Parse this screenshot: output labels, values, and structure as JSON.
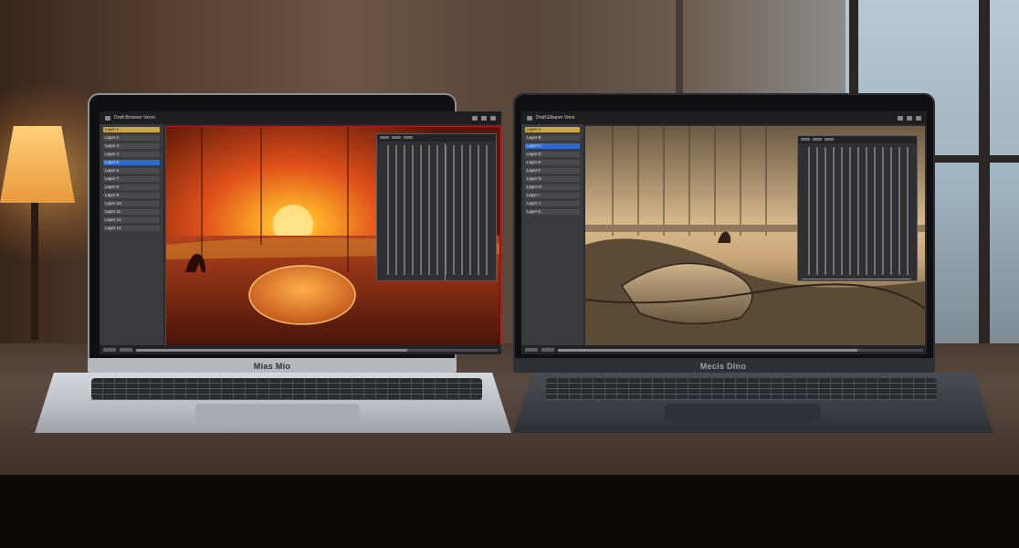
{
  "laptop_left": {
    "brand": "Mias Mio",
    "app_title": "Draft Browser Verso",
    "layers": [
      "Layer 1",
      "Layer 2",
      "Layer 3",
      "Layer 4",
      "Layer 5",
      "Layer 6",
      "Layer 7",
      "Layer 8",
      "Layer 9",
      "Layer 10",
      "Layer 11",
      "Layer 12",
      "Layer 13"
    ],
    "selected_layer_index": 4,
    "scroll_progress": 0.75
  },
  "laptop_right": {
    "brand": "Mecis Dlno",
    "app_title": "Draft Elbaren Vresi",
    "layers": [
      "Layer A",
      "Layer B",
      "Layer C",
      "Layer D",
      "Layer E",
      "Layer F",
      "Layer G",
      "Layer H",
      "Layer I",
      "Layer J",
      "Layer K"
    ],
    "selected_layer_index": 2,
    "scroll_progress": 0.82
  },
  "colors": {
    "accent_blue": "#2d6dd2",
    "selection_red": "#b02020",
    "sunset_orange": "#e0501a",
    "sepia_sky": "#c9a77a"
  },
  "icons": [
    "window-icon",
    "layers-icon",
    "zoom-icon",
    "menu-icon"
  ]
}
